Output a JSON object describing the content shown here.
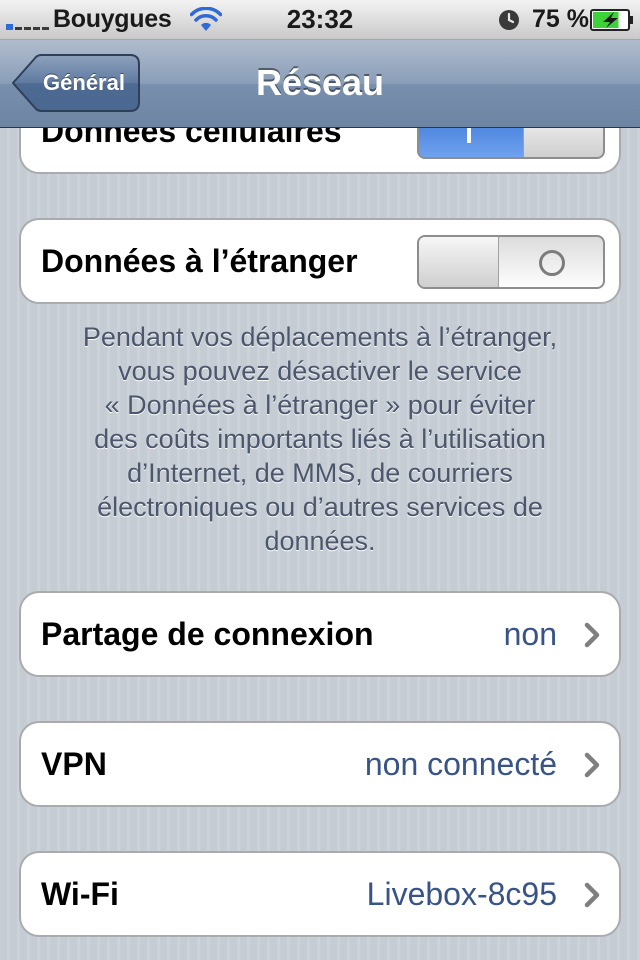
{
  "status_bar": {
    "carrier": "Bouygues",
    "time": "23:32",
    "battery_percent": "75 %",
    "signal_bars_active": 1,
    "signal_bars_total": 5,
    "icons": [
      "signal-icon",
      "wifi-icon",
      "alarm-icon",
      "battery-charging-icon"
    ],
    "battery_level": 0.75
  },
  "nav_bar": {
    "back_label": "Général",
    "title": "Réseau"
  },
  "cells": {
    "cellular_data": {
      "label": "Données cellulaires",
      "toggle_on": true
    },
    "data_roaming": {
      "label": "Données à l’étranger",
      "toggle_on": false
    },
    "tethering": {
      "label": "Partage de connexion",
      "value": "non"
    },
    "vpn": {
      "label": "VPN",
      "value": "non connecté"
    },
    "wifi": {
      "label": "Wi-Fi",
      "value": "Livebox-8c95"
    }
  },
  "roaming_footer": {
    "lines": [
      "Pendant vos déplacements à l’étranger,",
      "vous pouvez désactiver le service",
      "« Données à l’étranger » pour éviter",
      "des coûts importants liés à l’utilisation",
      "d’Internet, de MMS, de courriers",
      "électroniques ou d’autres services de",
      "données."
    ]
  },
  "colors": {
    "accent_blue": "#385487",
    "toggle_on": "#3a74d6",
    "nav_bar": "#7890ad",
    "background": "#c5ccd4",
    "battery_green": "#3ed13a"
  }
}
